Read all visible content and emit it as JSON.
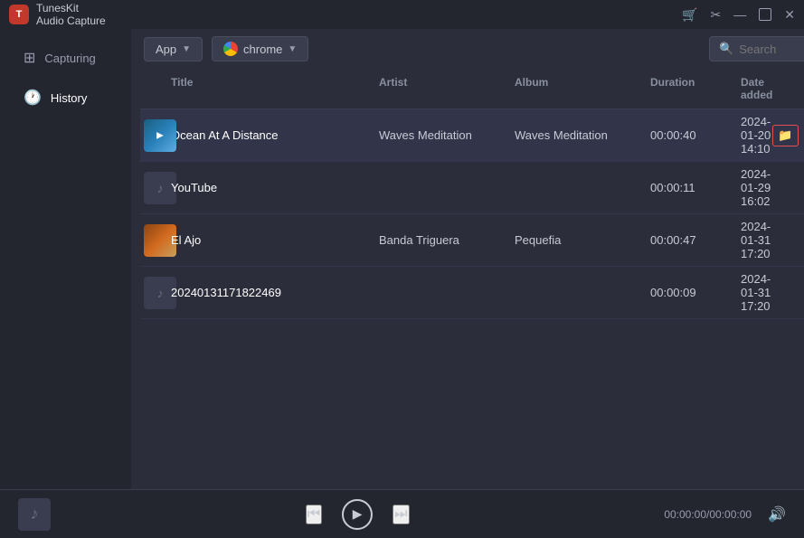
{
  "app": {
    "name_line1": "TunesKit",
    "name_line2": "Audio Capture",
    "logo_letter": "T"
  },
  "titlebar": {
    "cart_icon": "🛒",
    "scissors_icon": "✂",
    "minimize_icon": "—",
    "maximize_label": "□",
    "close_label": "✕"
  },
  "toolbar": {
    "app_dropdown_label": "App",
    "chrome_dropdown_label": "chrome",
    "search_placeholder": "Search"
  },
  "sidebar": {
    "items": [
      {
        "id": "capturing",
        "label": "Capturing",
        "icon": "⊞"
      },
      {
        "id": "history",
        "label": "History",
        "icon": "🕐"
      }
    ]
  },
  "table": {
    "headers": {
      "thumb": "",
      "title": "Title",
      "artist": "Artist",
      "album": "Album",
      "duration": "Duration",
      "date_added": "Date added"
    },
    "rows": [
      {
        "id": 1,
        "thumb_type": "ocean",
        "title": "Ocean At A Distance",
        "artist": "Waves Meditation",
        "album": "Waves Meditation",
        "duration": "00:00:40",
        "date_added": "2024-01-20 14:10",
        "selected": true
      },
      {
        "id": 2,
        "thumb_type": "music",
        "title": "YouTube",
        "artist": "",
        "album": "",
        "duration": "00:00:11",
        "date_added": "2024-01-29 16:02",
        "selected": false
      },
      {
        "id": 3,
        "thumb_type": "elajo",
        "title": "El Ajo",
        "artist": "Banda Triguera",
        "album": "Pequefia",
        "duration": "00:00:47",
        "date_added": "2024-01-31 17:20",
        "selected": false
      },
      {
        "id": 4,
        "thumb_type": "music",
        "title": "20240131171822469",
        "artist": "",
        "album": "",
        "duration": "00:00:09",
        "date_added": "2024-01-31 17:20",
        "selected": false
      }
    ]
  },
  "player": {
    "time_display": "00:00:00/00:00:00",
    "music_note": "♪"
  }
}
